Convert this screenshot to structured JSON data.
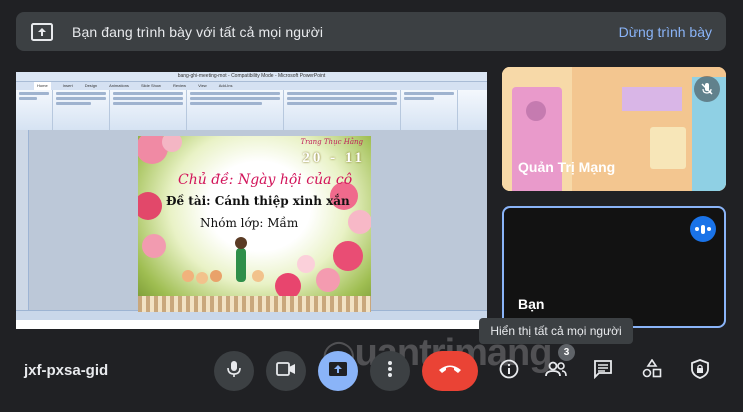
{
  "banner": {
    "message": "Bạn đang trình bày với tất cả mọi người",
    "stop_label": "Dừng trình bày"
  },
  "shared_screen": {
    "ppt_title": "bang-ghi-meeting-mot - Compatibility Mode - Microsoft PowerPoint",
    "ppt_tabs": [
      "Home",
      "Insert",
      "Design",
      "Animations",
      "Slide Show",
      "Review",
      "View",
      "Add-Ins"
    ],
    "slide": {
      "caption": "Trang Thục Hằng",
      "date": "20 - 11",
      "line1": "Chủ đề: Ngày hội của cô",
      "line2": "Đề tài: Cánh thiệp xinh xắn",
      "line3": "Nhóm lớp: Mầm"
    }
  },
  "participants": [
    {
      "name": "Quản Trị Mạng",
      "muted": true
    },
    {
      "name": "Bạn",
      "speaking": true
    }
  ],
  "tooltip": "Hiển thị tất cả mọi người",
  "meeting_code": "jxf-pxsa-gid",
  "controls": {
    "people_count": "3"
  },
  "watermark": "uantrimang",
  "colors": {
    "background": "#202124",
    "accent": "#8ab4f8",
    "hangup": "#ea4335",
    "speaking": "#1a73e8"
  },
  "icons": [
    "present-to-all-icon",
    "mic-icon",
    "mic-off-icon",
    "camera-icon",
    "present-icon",
    "more-icon",
    "hangup-icon",
    "info-icon",
    "people-icon",
    "chat-icon",
    "activities-icon",
    "host-controls-icon"
  ]
}
